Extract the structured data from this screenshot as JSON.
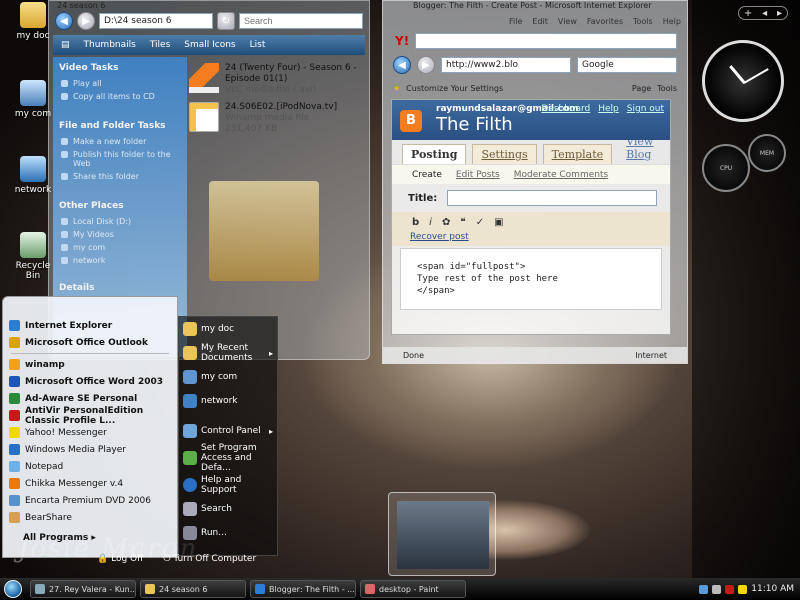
{
  "desktop": {
    "icons": [
      "my doc",
      "my com",
      "network",
      "Recycle Bin"
    ],
    "watermark": "Josie Maron"
  },
  "explorer": {
    "title": "24 season 6",
    "path": "D:\\24 season 6",
    "search_placeholder": "Search",
    "toolbar": [
      "Thumbnails",
      "Tiles",
      "Small Icons",
      "List"
    ],
    "sections": [
      {
        "title": "Video Tasks",
        "items": [
          "Play all",
          "Copy all items to CD"
        ]
      },
      {
        "title": "File and Folder Tasks",
        "items": [
          "Make a new folder",
          "Publish this folder to the Web",
          "Share this folder"
        ]
      },
      {
        "title": "Other Places",
        "items": [
          "Local Disk (D:)",
          "My Videos",
          "my com",
          "network"
        ]
      },
      {
        "title": "Details",
        "items": []
      }
    ],
    "files": [
      {
        "name": "24 (Twenty Four) - Season 6 - Episode 01(1)",
        "type": "VLC media file (.avi)",
        "size": ""
      },
      {
        "name": "24.S06E02.[iPodNova.tv]",
        "type": "Winamp media file",
        "size": "231,407 KB"
      }
    ]
  },
  "ie": {
    "title": "Blogger: The Filth - Create Post - Microsoft Internet Explorer",
    "menu": [
      "File",
      "Edit",
      "View",
      "Favorites",
      "Tools",
      "Help"
    ],
    "address": "http://www2.blo",
    "search_value": "Google",
    "tab_label": "Customize Your Settings",
    "page_label": "Page",
    "tools_label": "Tools",
    "status_left": "Done",
    "status_right": "Internet"
  },
  "blogger": {
    "email": "raymundsalazar@gmail.com",
    "links": [
      "Dashboard",
      "Help",
      "Sign out"
    ],
    "blog_title": "The Filth",
    "tabs": [
      "Posting",
      "Settings",
      "Template",
      "View Blog"
    ],
    "subtabs": [
      "Create",
      "Edit Posts",
      "Moderate Comments"
    ],
    "title_label": "Title:",
    "recover": "Recover post",
    "editor_text": "<span id=\"fullpost\">\nType rest of the post here\n</span>"
  },
  "startmenu": {
    "pinned": [
      "Internet Explorer",
      "Microsoft Office Outlook"
    ],
    "recent": [
      "winamp",
      "Microsoft Office Word 2003",
      "Ad-Aware SE Personal",
      "AntiVir PersonalEdition Classic Profile L...",
      "Yahoo! Messenger",
      "Windows Media Player",
      "Notepad",
      "Chikka Messenger v.4",
      "Encarta Premium DVD 2006",
      "BearShare"
    ],
    "all_programs": "All Programs",
    "right": [
      "my doc",
      "My Recent Documents",
      "my com",
      "network",
      "Control Panel",
      "Set Program Access and Defa...",
      "Help and Support",
      "Search",
      "Run..."
    ],
    "log_off": "Log Off",
    "turn_off": "Turn Off Computer"
  },
  "taskbar": {
    "buttons": [
      "27. Rey Valera - Kun...",
      "24 season 6",
      "Blogger: The Filth - ...",
      "desktop - Paint"
    ],
    "time": "11:10 AM"
  },
  "colors": {
    "accent": "#2a6fb6",
    "blogger_orange": "#f57c1f"
  }
}
